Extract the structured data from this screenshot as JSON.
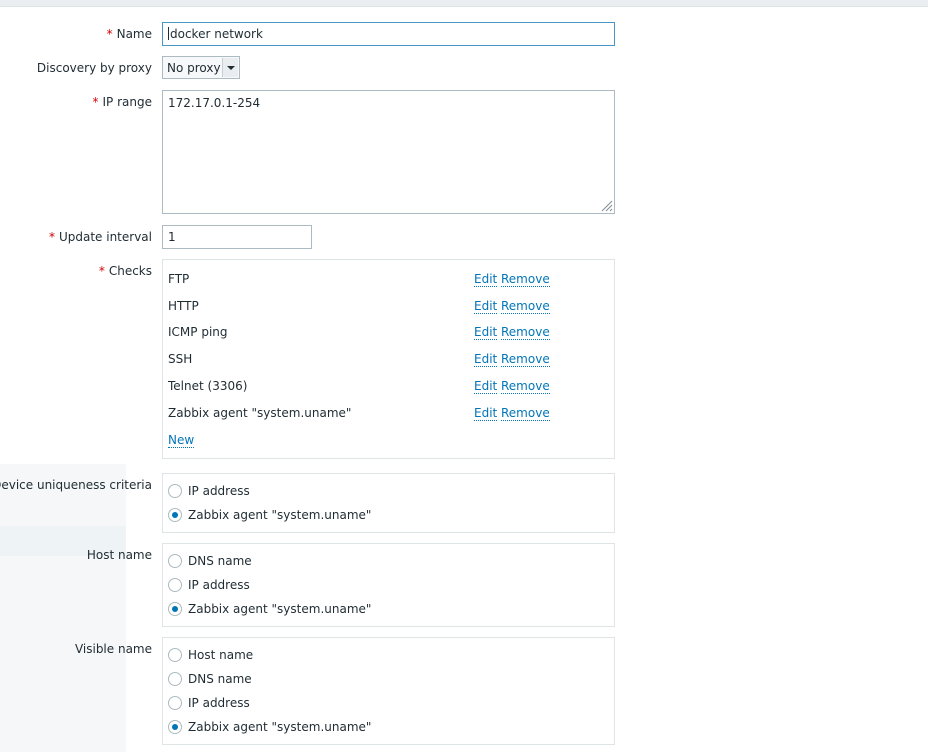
{
  "form": {
    "name": {
      "label": "Name",
      "required": "*",
      "value": "docker network"
    },
    "proxy": {
      "label": "Discovery by proxy",
      "value": "No proxy"
    },
    "ip_range": {
      "label": "IP range",
      "required": "*",
      "value": "172.17.0.1-254"
    },
    "update_interval": {
      "label": "Update interval",
      "required": "*",
      "value": "1"
    },
    "checks": {
      "label": "Checks",
      "required": "*",
      "items": [
        {
          "name": "FTP",
          "edit": "Edit",
          "remove": "Remove"
        },
        {
          "name": "HTTP",
          "edit": "Edit",
          "remove": "Remove"
        },
        {
          "name": "ICMP ping",
          "edit": "Edit",
          "remove": "Remove"
        },
        {
          "name": "SSH",
          "edit": "Edit",
          "remove": "Remove"
        },
        {
          "name": "Telnet (3306)",
          "edit": "Edit",
          "remove": "Remove"
        },
        {
          "name": "Zabbix agent \"system.uname\"",
          "edit": "Edit",
          "remove": "Remove"
        }
      ],
      "new_label": "New"
    },
    "uniqueness": {
      "label": "Device uniqueness criteria",
      "options": [
        "IP address",
        "Zabbix agent \"system.uname\""
      ],
      "selected": "Zabbix agent \"system.uname\""
    },
    "host_name": {
      "label": "Host name",
      "options": [
        "DNS name",
        "IP address",
        "Zabbix agent \"system.uname\""
      ],
      "selected": "Zabbix agent \"system.uname\""
    },
    "visible_name": {
      "label": "Visible name",
      "options": [
        "Host name",
        "DNS name",
        "IP address",
        "Zabbix agent \"system.uname\""
      ],
      "selected": "Zabbix agent \"system.uname\""
    }
  },
  "colors": {
    "accent": "#0275b8",
    "required": "#d40000",
    "border": "#acbbc2",
    "text": "#1f2c33"
  }
}
